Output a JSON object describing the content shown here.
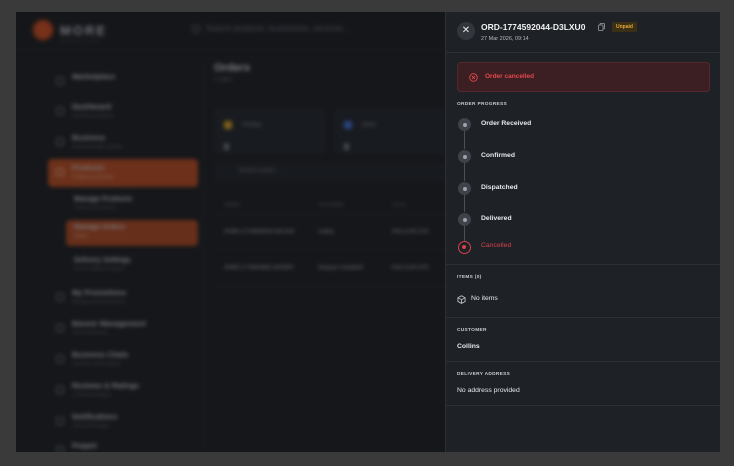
{
  "background_app": {
    "brand": "MORE",
    "brand_sub": "MARKETPLACE",
    "search_placeholder": "Search products, businesses, services...",
    "sidebar": [
      {
        "label": "Marketplace",
        "sub": ""
      },
      {
        "label": "Dashboard",
        "sub": "Overview & analytics"
      },
      {
        "label": "Business",
        "sub": "Business profile & details"
      },
      {
        "label": "Products",
        "sub": "Products & inventory"
      },
      {
        "label": "My Promotions",
        "sub": "Manage active promotions"
      },
      {
        "label": "Banner Management",
        "sub": "Ads & promotions"
      },
      {
        "label": "Business Chats",
        "sub": "Customer conversations"
      },
      {
        "label": "Reviews & Ratings",
        "sub": "Customer feedback"
      },
      {
        "label": "Notifications",
        "sub": "Alerts & messages"
      },
      {
        "label": "Poppie",
        "sub": ""
      }
    ],
    "sidebar_sub": [
      {
        "label": "Manage Products",
        "sub": "Products & inventory"
      },
      {
        "label": "Manage Orders",
        "sub": "Orders"
      },
      {
        "label": "Delivery Settings",
        "sub": "Fees & fulfillment options"
      }
    ],
    "orders_title": "Orders",
    "orders_count": "2 orders",
    "stats": [
      {
        "label": "Pending",
        "value": "0",
        "color": "#d9a21c"
      },
      {
        "label": "Active",
        "value": "0",
        "color": "#3a6bd4"
      }
    ],
    "orders_search": "Search orders...",
    "table": {
      "headers": [
        "ORDER",
        "CUSTOMER",
        "TOTAL"
      ],
      "rows": [
        [
          "#ORD-1774592044-D3LXU0",
          "Collins",
          "KSh 4,247,373"
        ],
        [
          "#ORD-1774524481-6KS0RT",
          "Dwayne Campbell",
          "KSh 4,247,373"
        ]
      ]
    }
  },
  "drawer": {
    "order_id": "ORD-1774592044-D3LXU0",
    "payment_badge": "Unpaid",
    "date": "27 Mar 2026, 09:14",
    "close_icon": "close-icon",
    "alert_text": "Order cancelled",
    "progress_label": "ORDER PROGRESS",
    "progress_steps": [
      {
        "label": "Order Received",
        "state": "pending"
      },
      {
        "label": "Confirmed",
        "state": "pending"
      },
      {
        "label": "Dispatched",
        "state": "pending"
      },
      {
        "label": "Delivered",
        "state": "pending"
      },
      {
        "label": "Cancelled",
        "state": "cancelled"
      }
    ],
    "items_label": "ITEMS (0)",
    "items_empty": "No items",
    "customer_label": "CUSTOMER",
    "customer_name": "Collins",
    "address_label": "DELIVERY ADDRESS",
    "address_value": "No address provided"
  },
  "colors": {
    "accent": "#b5461a",
    "danger": "#d6414a",
    "badge_text": "#e0a93a",
    "drawer_bg": "#1e2126"
  }
}
